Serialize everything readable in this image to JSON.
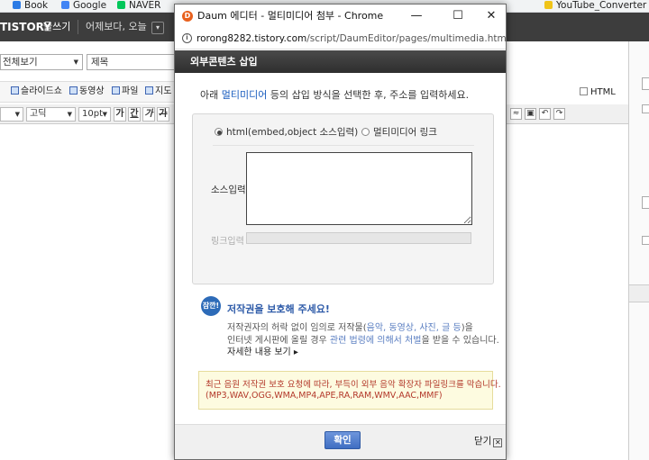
{
  "bookmarks": [
    {
      "label": "Book",
      "color": "#2c7be5"
    },
    {
      "label": "Google",
      "color": "#4285f4"
    },
    {
      "label": "NAVER",
      "color": "#03c75a"
    },
    {
      "label": "YouTube_Converter",
      "color": "#f0c419"
    }
  ],
  "tistory": {
    "logo": "TISTORY",
    "logo_sub": "글쓰기",
    "header_text": "어제보다, 오늘",
    "header_btn": "▾"
  },
  "editor": {
    "category": "전체보기",
    "title_placeholder": "제목",
    "toolbar": [
      {
        "label": "슬라이드쇼"
      },
      {
        "label": "동영상"
      },
      {
        "label": "파일"
      },
      {
        "label": "지도"
      }
    ],
    "font": "고딕",
    "font_size": "10pt",
    "format_buttons": [
      "가",
      "간",
      "가",
      "가"
    ],
    "html_toggle": "HTML"
  },
  "popup": {
    "window_title": "Daum 에디터 - 멀티미디어 첨부 - Chrome",
    "url_host": "rorong8282.tistory.com",
    "url_path": "/script/DaumEditor/pages/multimedia.html",
    "header_title": "외부콘텐츠 삽입",
    "instruction_prefix": "아래 ",
    "instruction_highlight": "멀티미디어",
    "instruction_suffix": " 등의 삽입 방식을 선택한 후, 주소를 입력하세요.",
    "radio_html": "html(embed,object 소스입력)",
    "radio_link": "멀티미디어 링크",
    "source_label": "소스입력",
    "link_label": "링크입력",
    "copyright": {
      "badge": "잠깐!",
      "title": "저작권을 보호해 주세요!",
      "line1_a": "저작권자의 허락 없이 임의로 저작물(",
      "line1_b": "음악, 동영상, 사진, 글 등",
      "line1_c": ")을",
      "line2_a": "인터넷 게시판에 올릴 경우 ",
      "line2_b": "관련 법령에 의해서 처벌",
      "line2_c": "을 받을 수 있습니다.",
      "more": "자세한 내용 보기 ▸"
    },
    "notice_line1": "최근 음원 저작권 보호 요청에 따라, 부득이 외부 음악 확장자 파일링크를 막습니다.",
    "notice_line2": "(MP3,WAV,OGG,WMA,MP4,APE,RA,RAM,WMV,AAC,MMF)",
    "ok_label": "확인",
    "close_label": "닫기"
  }
}
